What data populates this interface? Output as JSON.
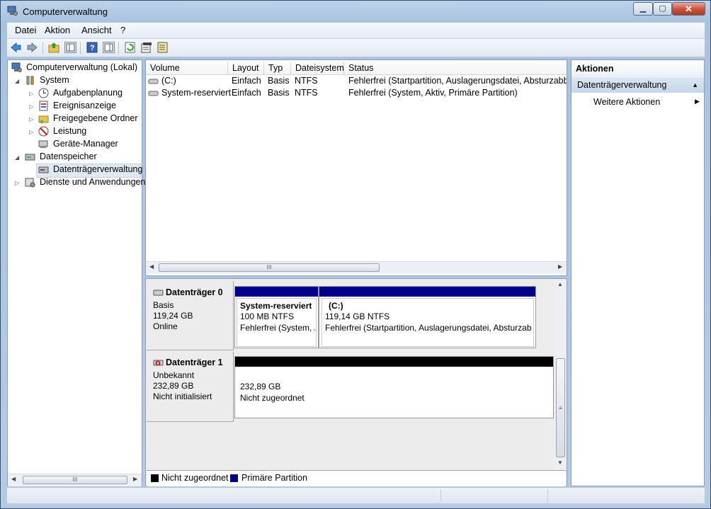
{
  "window": {
    "title": "Computerverwaltung",
    "min_glyph": "▁",
    "max_glyph": "▢",
    "close_glyph": "✕"
  },
  "menu": [
    "Datei",
    "Aktion",
    "Ansicht",
    "?"
  ],
  "tree": {
    "root": "Computerverwaltung (Lokal)",
    "system": "System",
    "aufgaben": "Aufgabenplanung",
    "ereignis": "Ereignisanzeige",
    "freigegeben": "Freigegebene Ordner",
    "leistung": "Leistung",
    "geraete": "Geräte-Manager",
    "datenspeicher": "Datenspeicher",
    "datentraeger": "Datenträgerverwaltung",
    "dienste": "Dienste und Anwendungen"
  },
  "volumes": {
    "headers": [
      "Volume",
      "Layout",
      "Typ",
      "Dateisystem",
      "Status"
    ],
    "rows": [
      [
        "(C:)",
        "Einfach",
        "Basis",
        "NTFS",
        "Fehlerfrei (Startpartition, Auslagerungsdatei, Absturzabbild"
      ],
      [
        "System-reserviert",
        "Einfach",
        "Basis",
        "NTFS",
        "Fehlerfrei (System, Aktiv, Primäre Partition)"
      ]
    ]
  },
  "disks": {
    "disk0": {
      "title": "Datenträger 0",
      "type": "Basis",
      "size": "119,24 GB",
      "state": "Online",
      "part1": {
        "name": "System-reserviert",
        "size": "100 MB NTFS",
        "status": "Fehlerfrei (System, A"
      },
      "part2": {
        "name": "(C:)",
        "size": "119,14 GB NTFS",
        "status": "Fehlerfrei (Startpartition, Auslagerungsdatei, Absturzabbl"
      }
    },
    "disk1": {
      "title": "Datenträger 1",
      "type": "Unbekannt",
      "size": "232,89 GB",
      "state": "Nicht initialisiert",
      "part1": {
        "size": "232,89 GB",
        "status": "Nicht zugeordnet"
      }
    }
  },
  "legend": {
    "unallocated": "Nicht zugeordnet",
    "primary": "Primäre Partition"
  },
  "colors": {
    "primary": "#00008b",
    "unallocated": "#000000"
  },
  "actions": {
    "title": "Aktionen",
    "section": "Datenträgerverwaltung",
    "more": "Weitere Aktionen"
  },
  "scroll_glyph": "III"
}
